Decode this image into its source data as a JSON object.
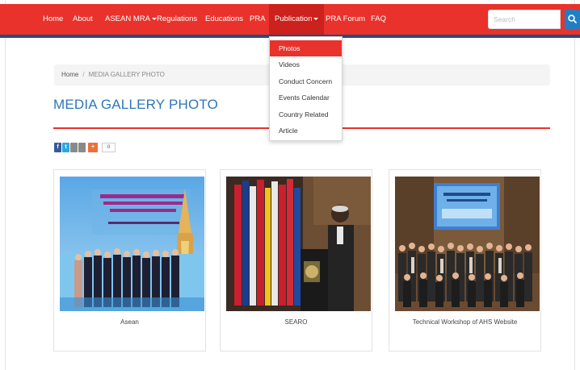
{
  "nav": {
    "items": [
      {
        "label": "Home"
      },
      {
        "label": "About"
      },
      {
        "label": "ASEAN MRA"
      },
      {
        "label": "Regulations"
      },
      {
        "label": "Educations"
      },
      {
        "label": "PRA"
      },
      {
        "label": "Publication"
      },
      {
        "label": "PRA Forum"
      },
      {
        "label": "FAQ"
      }
    ],
    "search_placeholder": "Search"
  },
  "dropdown": {
    "items": [
      {
        "label": "Photos"
      },
      {
        "label": "Videos"
      },
      {
        "label": "Conduct Concern"
      },
      {
        "label": "Events Calendar"
      },
      {
        "label": "Country Related"
      },
      {
        "label": "Article"
      }
    ]
  },
  "breadcrumb": {
    "home": "Home",
    "separator": "/",
    "current": "MEDIA GALLERY PHOTO"
  },
  "page_title": "MEDIA GALLERY PHOTO",
  "share": {
    "count": "0"
  },
  "gallery": {
    "cards": [
      {
        "caption": "Asean"
      },
      {
        "caption": "SEARO"
      },
      {
        "caption": "Technical Workshop of AHS Website"
      }
    ]
  },
  "colors": {
    "brand_red": "#e9322b",
    "navy_strip": "#2a4b7c",
    "title_blue": "#2e76b8",
    "search_blue": "#1f7ec5"
  }
}
